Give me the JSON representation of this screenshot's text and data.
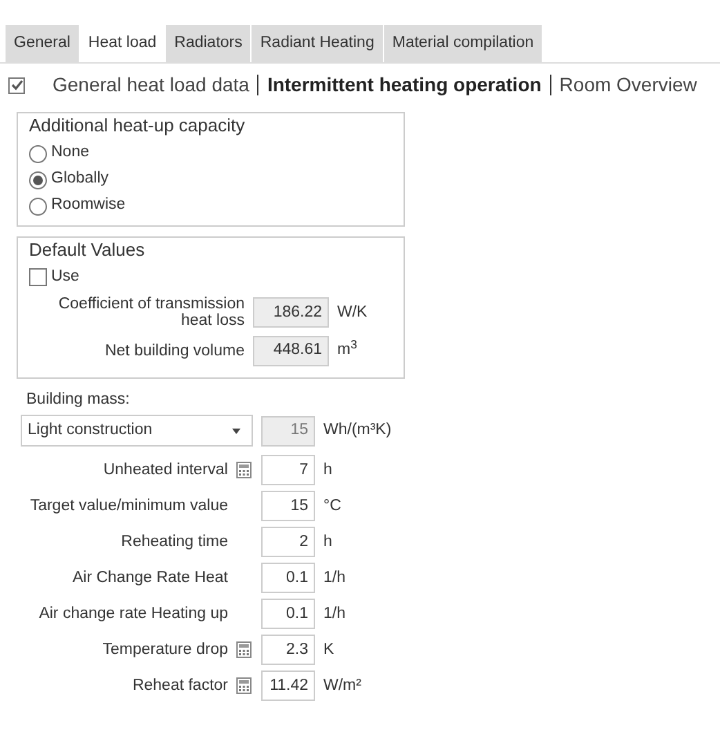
{
  "tabs": [
    {
      "label": "General",
      "selected": false
    },
    {
      "label": "Heat load",
      "selected": true
    },
    {
      "label": "Radiators",
      "selected": false
    },
    {
      "label": "Radiant Heating",
      "selected": false
    },
    {
      "label": "Material compilation",
      "selected": false
    }
  ],
  "breadcrumb": {
    "checked": true,
    "items": [
      {
        "label": "General heat load data",
        "selected": false
      },
      {
        "label": "Intermittent heating operation",
        "selected": true
      },
      {
        "label": "Room Overview",
        "selected": false
      }
    ]
  },
  "capacity_group": {
    "title": "Additional heat-up capacity",
    "options": [
      {
        "label": "None",
        "selected": false
      },
      {
        "label": "Globally",
        "selected": true
      },
      {
        "label": "Roomwise",
        "selected": false
      }
    ]
  },
  "defaults_group": {
    "title": "Default Values",
    "use": {
      "label": "Use",
      "checked": false
    },
    "fields": [
      {
        "label": "Coefficient of transmission heat loss",
        "value": "186.22",
        "unit": "W/K"
      },
      {
        "label": "Net building volume",
        "value": "448.61",
        "unit": "m$^{3}$"
      }
    ]
  },
  "building_mass": {
    "label": "Building mass:",
    "selection": "Light construction",
    "value": "15",
    "unit": "Wh/(m³K)"
  },
  "fields": [
    {
      "label": "Unheated interval",
      "calculator": true,
      "value": "7",
      "unit": "h"
    },
    {
      "label": "Target value/minimum value",
      "calculator": false,
      "value": "15",
      "unit": "°C"
    },
    {
      "label": "Reheating time",
      "calculator": false,
      "value": "2",
      "unit": "h"
    },
    {
      "label": "Air Change Rate Heat",
      "calculator": false,
      "value": "0.1",
      "unit": "1/h"
    },
    {
      "label": "Air change rate Heating up",
      "calculator": false,
      "value": "0.1",
      "unit": "1/h"
    },
    {
      "label": "Temperature drop",
      "calculator": true,
      "value": "2.3",
      "unit": "K"
    },
    {
      "label": "Reheat factor",
      "calculator": true,
      "value": "11.42",
      "unit": "W/m²"
    }
  ]
}
